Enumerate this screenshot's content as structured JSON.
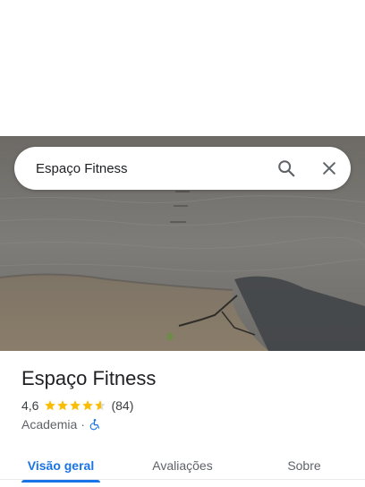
{
  "search": {
    "query": "Espaço Fitness"
  },
  "place": {
    "name": "Espaço Fitness",
    "rating": "4,6",
    "rating_value": 4.6,
    "review_count": "(84)",
    "category": "Academia",
    "separator": "·",
    "accessibility_icon": "wheelchair-icon"
  },
  "tabs": [
    {
      "label": "Visão geral",
      "active": true
    },
    {
      "label": "Avaliações",
      "active": false
    },
    {
      "label": "Sobre",
      "active": false
    }
  ],
  "colors": {
    "accent": "#1a73e8",
    "star": "#fbbc04",
    "text": "#202124",
    "secondary_text": "#5f6368"
  }
}
